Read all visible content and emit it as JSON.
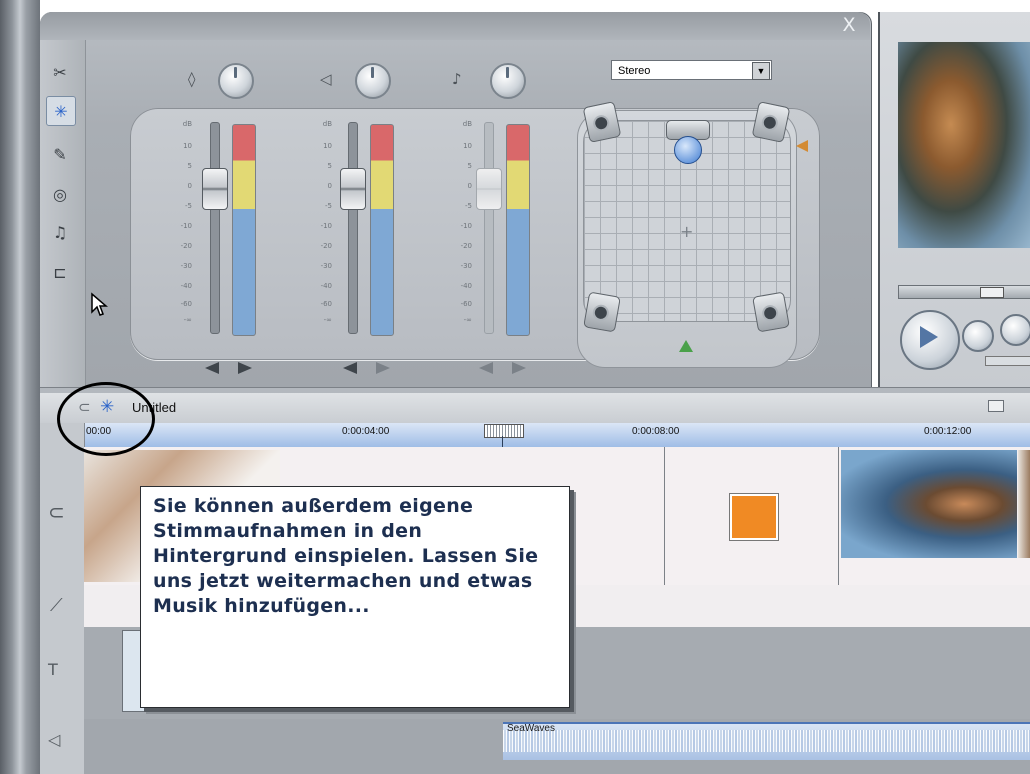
{
  "mixer": {
    "close_label": "X",
    "channels": [
      {
        "id": "video-audio",
        "icon": "camcorder-icon",
        "scale_label": "dB",
        "level_state": "active"
      },
      {
        "id": "sound-effects",
        "icon": "speaker-icon",
        "scale_label": "dB",
        "level_state": "active"
      },
      {
        "id": "music",
        "icon": "music-note-icon",
        "scale_label": "dB",
        "level_state": "inactive"
      }
    ],
    "db_scale": [
      "10",
      "5",
      "0",
      "-5",
      "-10",
      "-20",
      "-30",
      "-40",
      "-60",
      "-∞"
    ],
    "output_mode": "Stereo"
  },
  "tools": [
    {
      "icon": "video-tool-icon",
      "active": false
    },
    {
      "icon": "audio-mixer-icon",
      "active": true
    },
    {
      "icon": "narration-icon",
      "active": false
    },
    {
      "icon": "cd-icon",
      "active": false
    },
    {
      "icon": "music-icon",
      "active": false
    },
    {
      "icon": "plug-icon",
      "active": false
    }
  ],
  "timeline": {
    "project_title": "Untitled",
    "ruler_ticks": [
      "00:00",
      "0:00:04:00",
      "0:00:08:00",
      "0:00:12:00"
    ],
    "audio_clip_label": "SeaWaves"
  },
  "callout": {
    "text": "Sie können außerdem eigene Stimmaufnahmen in den Hintergrund einspielen. Lassen Sie uns jetzt weitermachen und etwas Musik hinzufügen..."
  },
  "colors": {
    "meter_red": "#d9686a",
    "meter_yellow": "#e2d974",
    "meter_blue": "#7fa8d4",
    "ruler_blue": "#9fbde6",
    "callout_text": "#1d2f50"
  }
}
